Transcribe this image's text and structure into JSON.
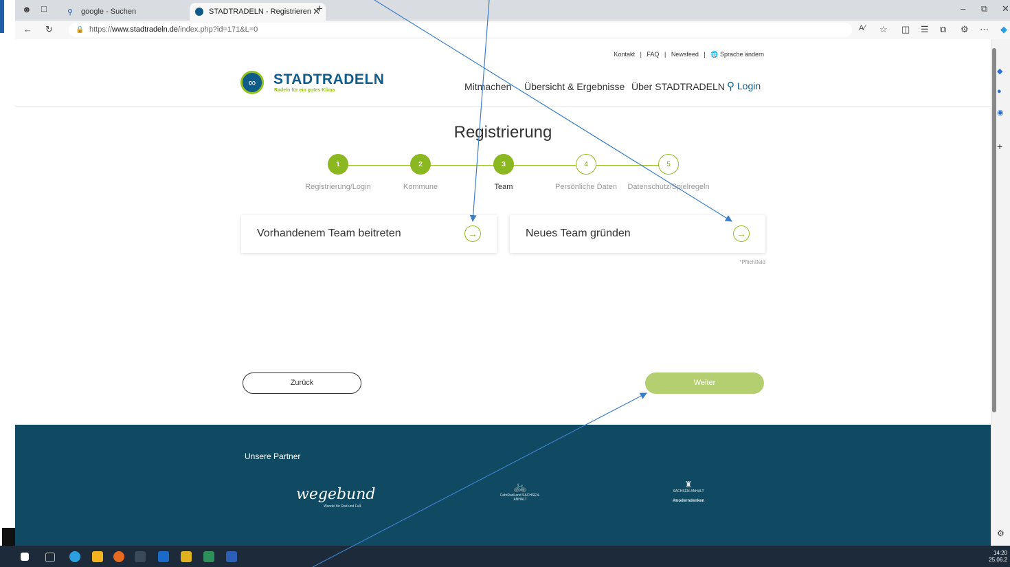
{
  "browser": {
    "tabs": [
      {
        "title": "google - Suchen"
      },
      {
        "title": "STADTRADELN - Registrieren"
      }
    ],
    "url_prefix": "https://",
    "url_host": "www.stadtradeln.de",
    "url_path": "/index.php?id=171&L=0"
  },
  "header": {
    "top_links": [
      "Kontakt",
      "FAQ",
      "Newsfeed",
      "Sprache ändern"
    ],
    "logo_title": "STADTRADELN",
    "logo_subtitle": "Radeln für ein gutes Klima",
    "nav": [
      "Mitmachen",
      "Übersicht & Ergebnisse",
      "Über STADTRADELN"
    ],
    "login": "Login"
  },
  "registration": {
    "title": "Registrierung",
    "steps": [
      {
        "number": "1",
        "label": "Registrierung/Login",
        "state": "done"
      },
      {
        "number": "2",
        "label": "Kommune",
        "state": "done"
      },
      {
        "number": "3",
        "label": "Team",
        "state": "current"
      },
      {
        "number": "4",
        "label": "Persönliche Daten",
        "state": "todo"
      },
      {
        "number": "5",
        "label": "Datenschutz/Spielregeln",
        "state": "todo"
      }
    ],
    "options": [
      {
        "label": "Vorhandenem Team beitreten"
      },
      {
        "label": "Neues Team gründen"
      }
    ],
    "required_note": "*Pflichtfeld",
    "back_label": "Zurück",
    "next_label": "Weiter"
  },
  "footer": {
    "partners_title": "Unsere Partner",
    "partner1_name": "wegebund",
    "partner1_sub": "Wandel für Rad und Fuß",
    "partner2_name": "FahrRadLand SACHSEN-ANHALT",
    "partner3_name": "SACHSEN-ANHALT",
    "partner3_tag": "#moderndenken"
  },
  "taskbar": {
    "time": "14:20",
    "date": "25.06.2"
  },
  "colors": {
    "brand_blue": "#0f5c8a",
    "brand_green": "#94c11f",
    "footer_bg": "#0f4a62",
    "annotation_arrow": "#3c7fc7"
  }
}
